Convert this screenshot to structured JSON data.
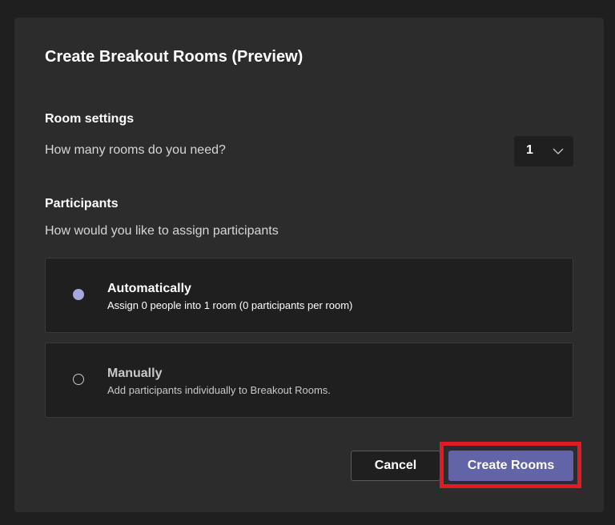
{
  "dialog": {
    "title": "Create Breakout Rooms (Preview)"
  },
  "room_settings": {
    "label": "Room settings",
    "question": "How many rooms do you need?",
    "rooms_value": "1",
    "dropdown_icon": "chevron-down-icon"
  },
  "participants": {
    "label": "Participants",
    "question": "How would you like to assign participants",
    "options": [
      {
        "title": "Automatically",
        "description": "Assign 0 people into 1 room (0 participants per room)",
        "selected": true
      },
      {
        "title": "Manually",
        "description": "Add participants individually to Breakout Rooms.",
        "selected": false
      }
    ]
  },
  "buttons": {
    "cancel_label": "Cancel",
    "create_label": "Create Rooms"
  },
  "colors": {
    "background": "#1f1f1f",
    "dialog": "#2d2c2c",
    "accent": "#6264a7",
    "radio_selected": "#a6a7dc",
    "highlight": "#e01b24"
  }
}
